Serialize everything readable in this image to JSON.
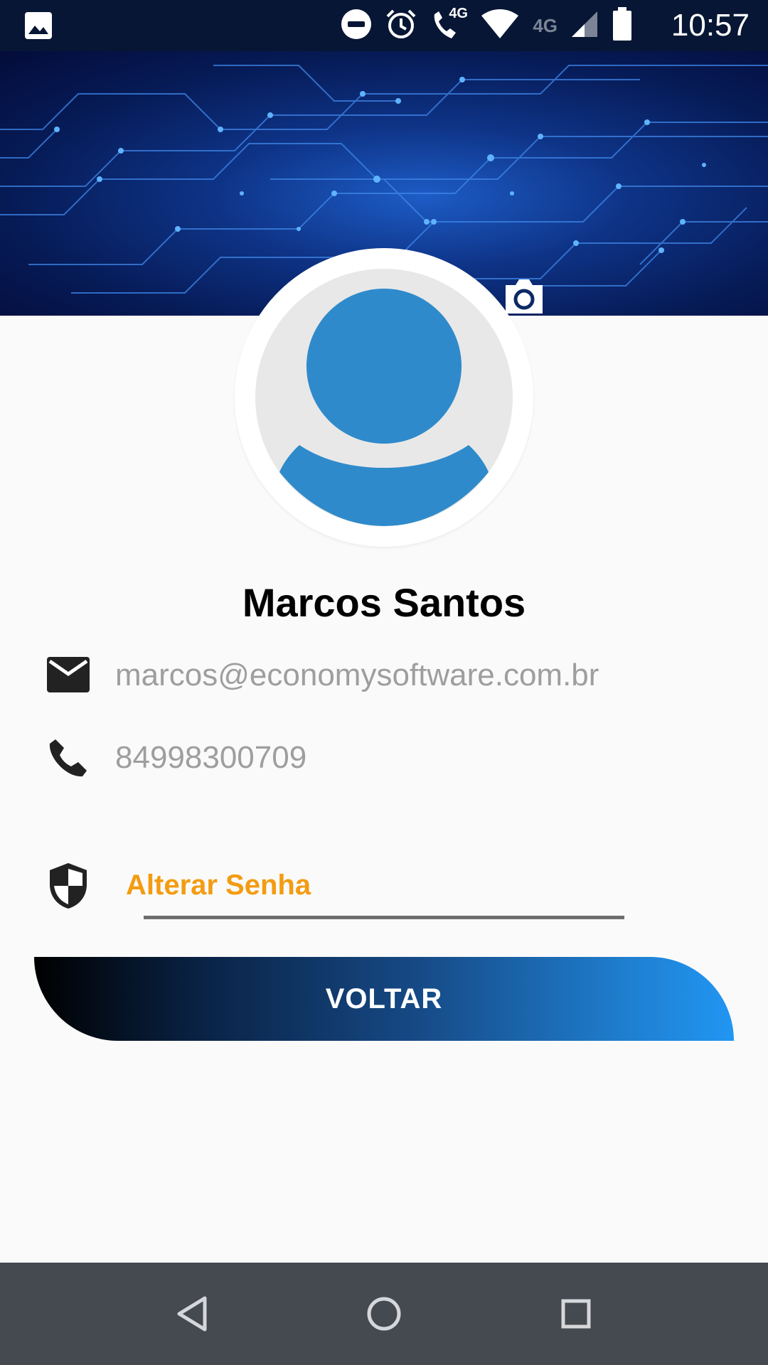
{
  "status_bar": {
    "time": "10:57",
    "network_primary": "4G",
    "network_secondary": "4G",
    "icons": [
      "image-icon",
      "do-not-disturb-icon",
      "alarm-icon",
      "wifi-calling-icon",
      "wifi-icon",
      "signal-icon",
      "battery-icon"
    ]
  },
  "profile": {
    "name": "Marcos Santos",
    "email": "marcos@economysoftware.com.br",
    "phone": "84998300709",
    "change_password_label": "Alterar Senha",
    "back_button_label": "VOLTAR"
  },
  "colors": {
    "status_bar_bg": "#071634",
    "avatar_blue": "#2f8acb",
    "link_orange": "#f39c12",
    "nav_bar_bg": "#454a50"
  }
}
